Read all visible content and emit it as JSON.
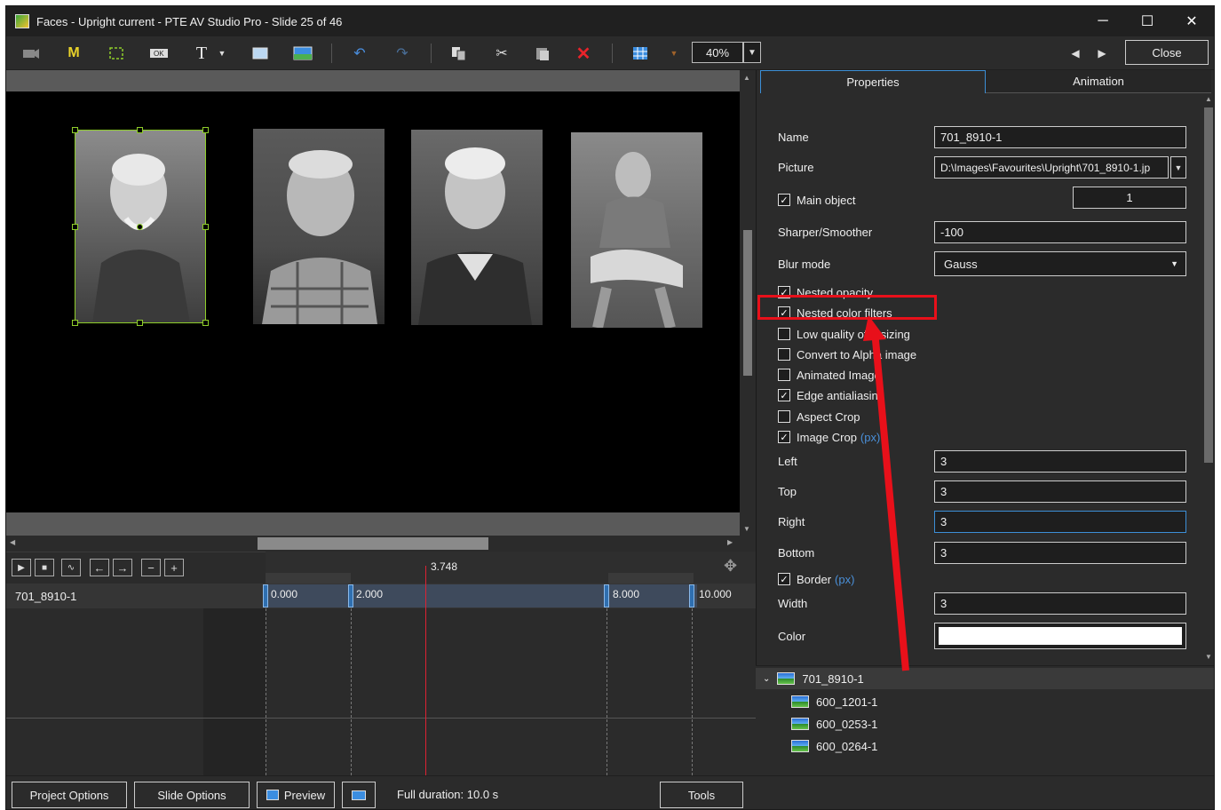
{
  "window": {
    "title": "Faces - Upright current - PTE AV Studio Pro - Slide 25 of 46",
    "controls": {
      "minimize": "─",
      "maximize": "☐",
      "close": "✕"
    }
  },
  "toolbar": {
    "zoom": "40%",
    "close_label": "Close",
    "m_label": "M",
    "t_label": "T",
    "ok_label": "OK"
  },
  "properties_panel": {
    "tabs": [
      {
        "label": "Properties",
        "active": true
      },
      {
        "label": "Animation",
        "active": false
      }
    ],
    "name_label": "Name",
    "name_value": "701_8910-1",
    "picture_label": "Picture",
    "picture_value": "D:\\Images\\Favourites\\Upright\\701_8910-1.jp",
    "main_object_label": "Main object",
    "main_object_value": "1",
    "sharper_label": "Sharper/Smoother",
    "sharper_value": "-100",
    "blur_label": "Blur mode",
    "blur_value": "Gauss",
    "checks": [
      {
        "label": "Nested opacity",
        "checked": true
      },
      {
        "label": "Nested color filters",
        "checked": true
      },
      {
        "label": "Low quality of resizing",
        "checked": false
      },
      {
        "label": "Convert to Alpha image",
        "checked": false
      },
      {
        "label": "Animated Image",
        "checked": false
      },
      {
        "label": "Edge antialiasing",
        "checked": true
      },
      {
        "label": "Aspect Crop",
        "checked": false
      },
      {
        "label": "Image Crop",
        "checked": true
      }
    ],
    "px_unit": "(px)",
    "left_label": "Left",
    "left_value": "3",
    "top_label": "Top",
    "top_value": "3",
    "right_label": "Right",
    "right_value": "3",
    "bottom_label": "Bottom",
    "bottom_value": "3",
    "border_label": "Border",
    "width_label": "Width",
    "width_value": "3",
    "color_label": "Color",
    "color_value": "#ffffff"
  },
  "object_tree": {
    "root": "701_8910-1",
    "children": [
      "600_1201-1",
      "600_0253-1",
      "600_0264-1"
    ]
  },
  "timeline": {
    "object_name": "701_8910-1",
    "cursor_time": "3.748",
    "keyframes": [
      "0.000",
      "2.000",
      "8.000",
      "10.000"
    ]
  },
  "bottom_bar": {
    "project_options": "Project Options",
    "slide_options": "Slide Options",
    "preview": "Preview",
    "full_duration": "Full duration: 10.0 s",
    "tools": "Tools"
  },
  "colors": {
    "highlight": "#e8101a",
    "selection": "#8fce2a",
    "accent": "#3c8fd6"
  }
}
